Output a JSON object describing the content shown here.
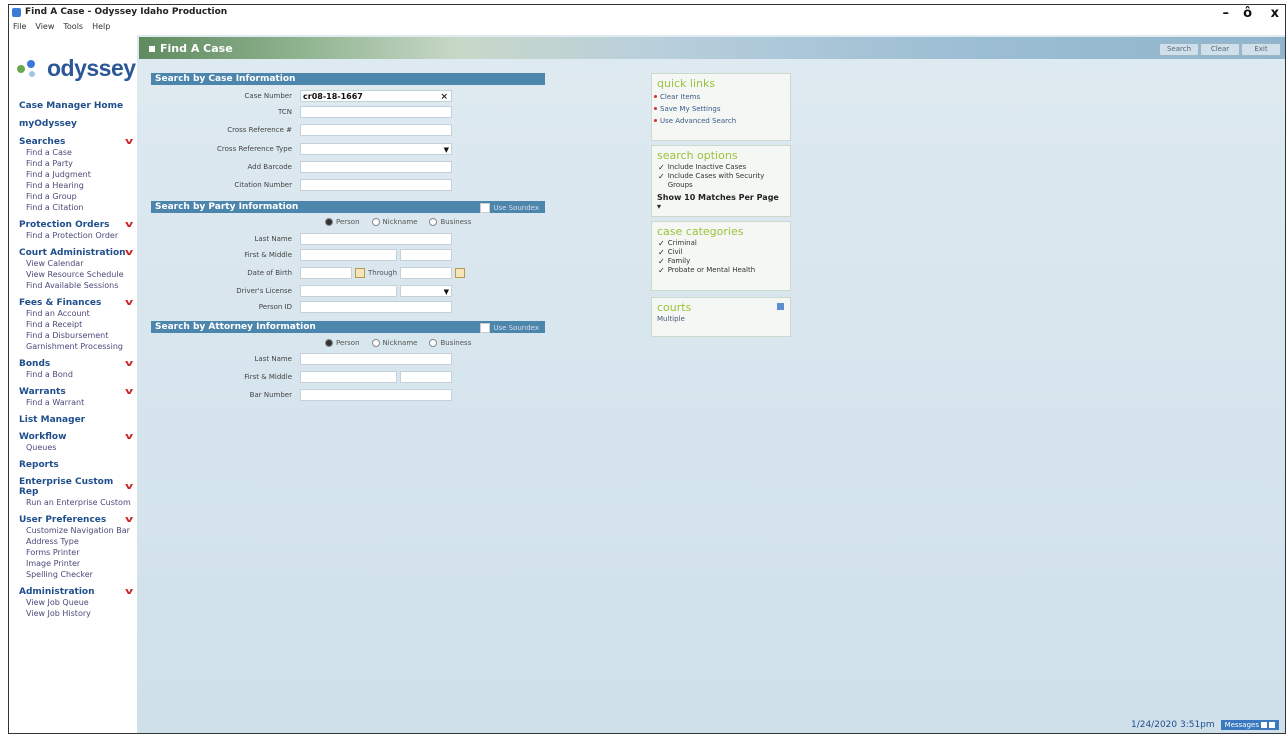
{
  "window": {
    "title": "Find A Case - Odyssey Idaho Production",
    "controls": {
      "minimize": "–",
      "maximize": "ô",
      "close": "x"
    }
  },
  "menu": [
    "File",
    "View",
    "Tools",
    "Help"
  ],
  "logo": {
    "text": "odyssey"
  },
  "nav": {
    "top_links": [
      "Case Manager Home",
      "myOdyssey"
    ],
    "groups": [
      {
        "title": "Searches",
        "items": [
          "Find a Case",
          "Find a Party",
          "Find a Judgment",
          "Find a Hearing",
          "Find a Group",
          "Find a Citation"
        ]
      },
      {
        "title": "Protection Orders",
        "items": [
          "Find a Protection Order"
        ]
      },
      {
        "title": "Court Administration",
        "items": [
          "View Calendar",
          "View Resource Schedule",
          "Find Available Sessions"
        ]
      },
      {
        "title": "Fees & Finances",
        "items": [
          "Find an Account",
          "Find a Receipt",
          "Find a Disbursement",
          "Garnishment Processing"
        ]
      },
      {
        "title": "Bonds",
        "items": [
          "Find a Bond"
        ]
      },
      {
        "title": "Warrants",
        "items": [
          "Find a Warrant"
        ]
      },
      {
        "title": "List Manager",
        "items": []
      },
      {
        "title": "Workflow",
        "items": [
          "Queues"
        ]
      },
      {
        "title": "Reports",
        "items": []
      },
      {
        "title": "Enterprise Custom Rep",
        "items": [
          "Run an Enterprise Custom"
        ]
      },
      {
        "title": "User Preferences",
        "items": [
          "Customize Navigation Bar",
          "Address Type",
          "Forms Printer",
          "Image Printer",
          "Spelling Checker"
        ]
      },
      {
        "title": "Administration",
        "items": [
          "View Job Queue",
          "View Job History"
        ]
      }
    ]
  },
  "header": {
    "title": "Find A Case",
    "buttons": [
      "Search",
      "Clear",
      "Exit"
    ]
  },
  "case_info": {
    "heading": "Search by Case Information",
    "labels": [
      "Case Number",
      "TCN",
      "Cross Reference #",
      "Cross Reference Type",
      "Add Barcode",
      "Citation Number"
    ],
    "case_number_value": "cr08-18-1667"
  },
  "party_info": {
    "heading": "Search by Party Information",
    "soundex": "Use Soundex",
    "radios": [
      "Person",
      "Nickname",
      "Business"
    ],
    "labels": [
      "Last Name",
      "First & Middle",
      "Date of Birth",
      "Driver's License",
      "Person ID"
    ],
    "through": "Through"
  },
  "attorney_info": {
    "heading": "Search by Attorney Information",
    "soundex": "Use Soundex",
    "radios": [
      "Person",
      "Nickname",
      "Business"
    ],
    "labels": [
      "Last Name",
      "First & Middle",
      "Bar Number"
    ]
  },
  "quick_links": {
    "title": "quick links",
    "links": [
      "Clear Items",
      "Save My Settings",
      "Use Advanced Search"
    ]
  },
  "search_options": {
    "title": "search options",
    "checks": [
      "Include Inactive Cases",
      "Include Cases with Security Groups"
    ],
    "matches": "Show 10 Matches Per Page"
  },
  "case_categories": {
    "title": "case categories",
    "checks": [
      "Criminal",
      "Civil",
      "Family",
      "Probate or Mental Health"
    ]
  },
  "courts": {
    "title": "courts",
    "value": "Multiple"
  },
  "status": {
    "timestamp": "1/24/2020 3:51pm",
    "messages": "Messages"
  },
  "colors": {
    "section_header": "#4d86ad",
    "nav_title": "#1f4e8c",
    "panel_title": "#9cc13d",
    "chevron": "#cc2222"
  }
}
